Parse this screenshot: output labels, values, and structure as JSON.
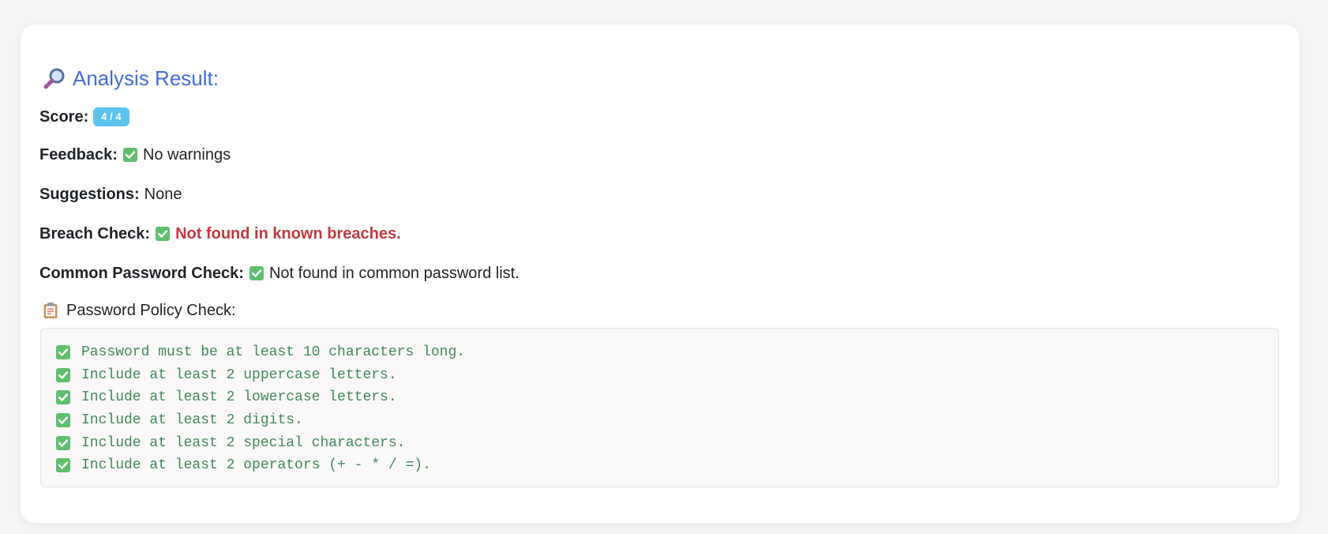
{
  "title": "Analysis Result:",
  "score": {
    "label": "Score:",
    "value": "4 / 4"
  },
  "feedback": {
    "label": "Feedback:",
    "value": "No warnings"
  },
  "suggestions": {
    "label": "Suggestions:",
    "value": "None"
  },
  "breach": {
    "label": "Breach Check:",
    "value": "Not found in known breaches."
  },
  "common": {
    "label": "Common Password Check:",
    "value": "Not found in common password list."
  },
  "policy": {
    "title": "Password Policy Check:",
    "items": [
      "Password must be at least 10 characters long.",
      "Include at least 2 uppercase letters.",
      "Include at least 2 lowercase letters.",
      "Include at least 2 digits.",
      "Include at least 2 special characters.",
      "Include at least 2 operators (+ - * / =)."
    ]
  },
  "colors": {
    "title": "#3f6ed8",
    "badge": "#5cc3ec",
    "danger": "#c0393f",
    "policy_text": "#3f8a5a",
    "check": "#5fbf6e"
  },
  "icons": {
    "title": "magnifier-icon",
    "check": "check-mark-button-icon",
    "policy": "clipboard-icon"
  }
}
